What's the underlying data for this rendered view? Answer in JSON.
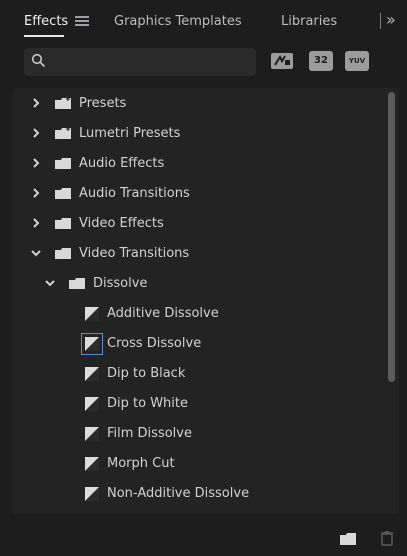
{
  "tabs": {
    "effects": "Effects",
    "graphics_templates": "Graphics Templates",
    "libraries": "Libraries",
    "more": "»"
  },
  "search": {
    "value": "",
    "placeholder": ""
  },
  "filters": [
    {
      "icon": "accelerated-effects-icon",
      "label": ""
    },
    {
      "icon": "32-bit-color-icon",
      "label": "32"
    },
    {
      "icon": "yuv-effects-icon",
      "label": "YUV"
    }
  ],
  "tree": [
    {
      "label": "Presets",
      "type": "special-folder",
      "expanded": false
    },
    {
      "label": "Lumetri Presets",
      "type": "special-folder",
      "expanded": false
    },
    {
      "label": "Audio Effects",
      "type": "folder",
      "expanded": false
    },
    {
      "label": "Audio Transitions",
      "type": "folder",
      "expanded": false
    },
    {
      "label": "Video Effects",
      "type": "folder",
      "expanded": false
    },
    {
      "label": "Video Transitions",
      "type": "folder",
      "expanded": true
    },
    {
      "label": "Dissolve",
      "type": "folder",
      "expanded": true
    },
    {
      "label": "Additive Dissolve",
      "type": "effect"
    },
    {
      "label": "Cross Dissolve",
      "type": "effect",
      "selected": true
    },
    {
      "label": "Dip to Black",
      "type": "effect"
    },
    {
      "label": "Dip to White",
      "type": "effect"
    },
    {
      "label": "Film Dissolve",
      "type": "effect"
    },
    {
      "label": "Morph Cut",
      "type": "effect"
    },
    {
      "label": "Non-Additive Dissolve",
      "type": "effect"
    }
  ],
  "colors": {
    "panel_bg": "#1d1d1d",
    "tree_bg": "#232323",
    "text": "#d2d2d2",
    "accent": "#5f8bd6"
  }
}
